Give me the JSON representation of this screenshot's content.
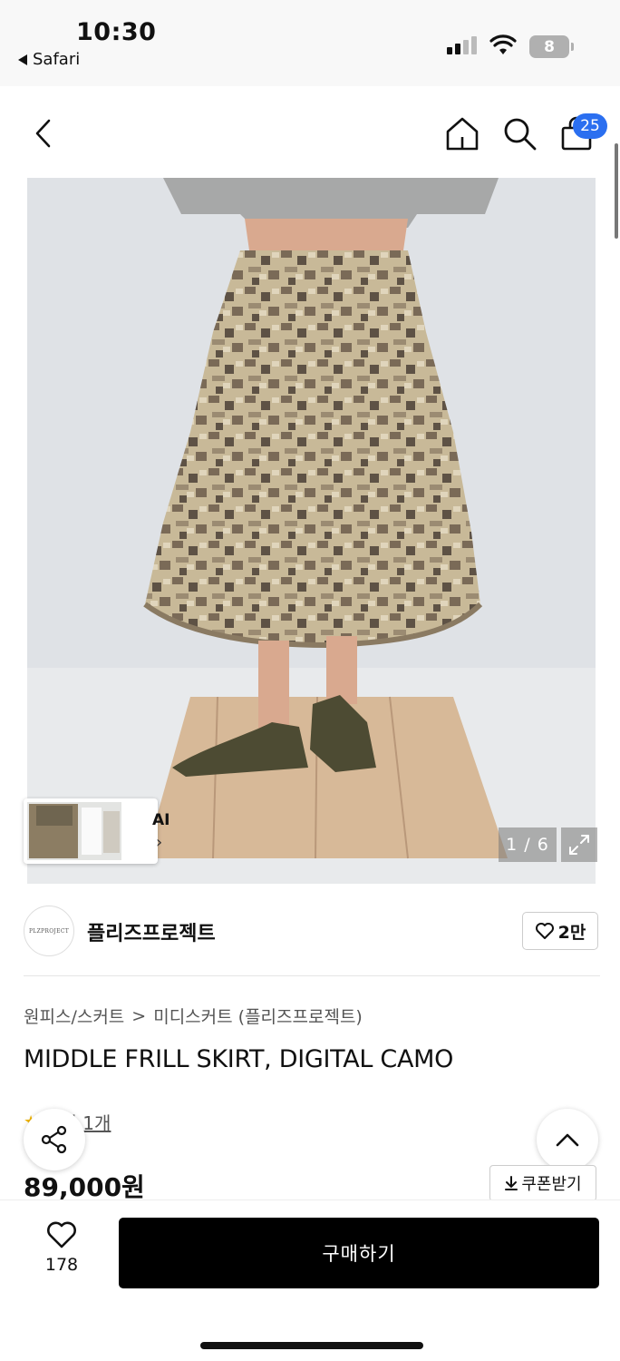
{
  "status_bar": {
    "time": "10:30",
    "back_app": "Safari",
    "battery": "8"
  },
  "nav": {
    "cart_count": "25"
  },
  "gallery": {
    "ai_label": "AI",
    "ai_arrow": "›",
    "page_indicator": "1 / 6"
  },
  "brand": {
    "logo_text": "PLZPROJECT",
    "name": "플리즈프로젝트",
    "likes": "2만"
  },
  "product": {
    "breadcrumb": [
      "원피스/스커트",
      ">",
      "미디스커트 (플리즈프로젝트)"
    ],
    "title": "MIDDLE FRILL SKIRT, DIGITAL CAMO",
    "review_label": "후기 1개",
    "price": "89,000원"
  },
  "actions": {
    "coupon_label": "쿠폰받기",
    "wish_count": "178",
    "buy_label": "구매하기"
  },
  "icons": [
    "chevron-left-icon",
    "home-icon",
    "search-icon",
    "bag-icon",
    "expand-icon",
    "heart-icon",
    "share-icon",
    "chevron-up-icon",
    "download-icon"
  ]
}
